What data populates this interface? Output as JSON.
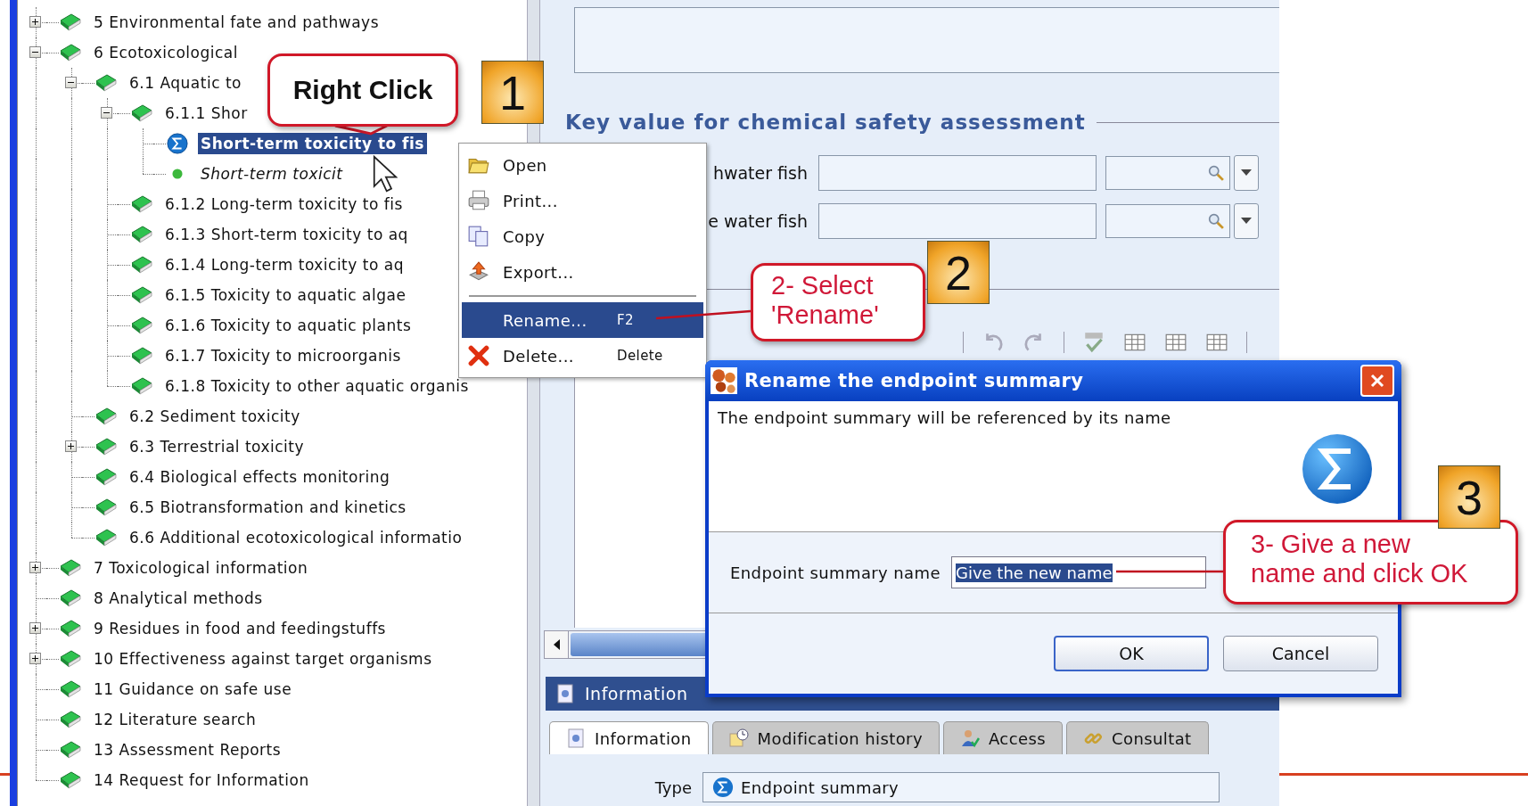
{
  "tree": {
    "items": [
      {
        "kind": "book",
        "label": "5 Environmental fate and pathways",
        "expanded": false,
        "selected": false
      },
      {
        "kind": "book",
        "label": "6 Ecotoxicological",
        "expanded": true,
        "selected": false,
        "children": [
          {
            "kind": "book",
            "label": "6.1 Aquatic to",
            "expanded": true,
            "selected": false,
            "children": [
              {
                "kind": "book",
                "label": "6.1.1 Shor",
                "expanded": true,
                "selected": false,
                "children": [
                  {
                    "kind": "summary",
                    "label": "Short-term toxicity to fis",
                    "selected": true
                  },
                  {
                    "kind": "record",
                    "label": "Short-term toxicit",
                    "selected": false
                  }
                ]
              },
              {
                "kind": "book",
                "label": "6.1.2 Long-term toxicity to fis",
                "selected": false
              },
              {
                "kind": "book",
                "label": "6.1.3 Short-term toxicity to aq",
                "selected": false
              },
              {
                "kind": "book",
                "label": "6.1.4 Long-term toxicity to aq",
                "selected": false
              },
              {
                "kind": "book",
                "label": "6.1.5 Toxicity to aquatic algae",
                "selected": false
              },
              {
                "kind": "book",
                "label": "6.1.6 Toxicity to aquatic plants",
                "selected": false
              },
              {
                "kind": "book",
                "label": "6.1.7 Toxicity to microorganis",
                "selected": false
              },
              {
                "kind": "book",
                "label": "6.1.8 Toxicity to other aquatic organis",
                "selected": false
              }
            ]
          },
          {
            "kind": "book",
            "label": "6.2 Sediment toxicity",
            "selected": false
          },
          {
            "kind": "book",
            "label": "6.3 Terrestrial toxicity",
            "expanded": false,
            "selected": false
          },
          {
            "kind": "book",
            "label": "6.4 Biological effects monitoring",
            "selected": false
          },
          {
            "kind": "book",
            "label": "6.5 Biotransformation and kinetics",
            "selected": false
          },
          {
            "kind": "book",
            "label": "6.6 Additional ecotoxicological informatio",
            "selected": false
          }
        ]
      },
      {
        "kind": "book",
        "label": "7 Toxicological information",
        "expanded": false,
        "selected": false
      },
      {
        "kind": "book",
        "label": "8 Analytical methods",
        "selected": false
      },
      {
        "kind": "book",
        "label": "9 Residues in food and feedingstuffs",
        "expanded": false,
        "selected": false
      },
      {
        "kind": "book",
        "label": "10 Effectiveness against target organisms",
        "expanded": false,
        "selected": false
      },
      {
        "kind": "book",
        "label": "11 Guidance on safe use",
        "selected": false
      },
      {
        "kind": "book",
        "label": "12 Literature search",
        "selected": false
      },
      {
        "kind": "book",
        "label": "13 Assessment Reports",
        "selected": false
      },
      {
        "kind": "book",
        "label": "14 Request for Information",
        "selected": false
      }
    ]
  },
  "editor": {
    "section_title": "Key value for chemical safety assessment",
    "fields": [
      {
        "label": "hwater fish"
      },
      {
        "label": "e water fish"
      }
    ]
  },
  "information_panel": {
    "title": "Information",
    "tabs": [
      {
        "label": "Information",
        "selected": true
      },
      {
        "label": "Modification history",
        "selected": false
      },
      {
        "label": "Access",
        "selected": false
      },
      {
        "label": "Consultat",
        "selected": false
      }
    ],
    "type_label": "Type",
    "type_value": "Endpoint summary"
  },
  "context_menu": {
    "items": [
      {
        "kind": "open",
        "label": "Open",
        "selected": false
      },
      {
        "kind": "print",
        "label": "Print...",
        "selected": false
      },
      {
        "kind": "copy",
        "label": "Copy",
        "selected": false
      },
      {
        "kind": "export",
        "label": "Export...",
        "selected": false
      },
      {
        "kind": "separator"
      },
      {
        "kind": "rename",
        "label": "Rename...",
        "shortcut": "F2",
        "selected": true
      },
      {
        "kind": "delete",
        "label": "Delete...",
        "shortcut": "Delete",
        "selected": false
      }
    ]
  },
  "dialog": {
    "title": "Rename the endpoint summary",
    "message": "The endpoint summary will be referenced by its name",
    "field_label": "Endpoint summary name",
    "field_value": "Give the new name",
    "buttons": [
      {
        "label": "OK",
        "default": true
      },
      {
        "label": "Cancel",
        "default": false
      }
    ]
  },
  "callouts": [
    {
      "lines": [
        "Right Click"
      ]
    },
    {
      "lines": [
        "2- Select",
        "'Rename'"
      ]
    },
    {
      "lines": [
        "3- Give a new",
        "name and click OK"
      ]
    }
  ],
  "step_badges": [
    "1",
    "2",
    "3"
  ]
}
